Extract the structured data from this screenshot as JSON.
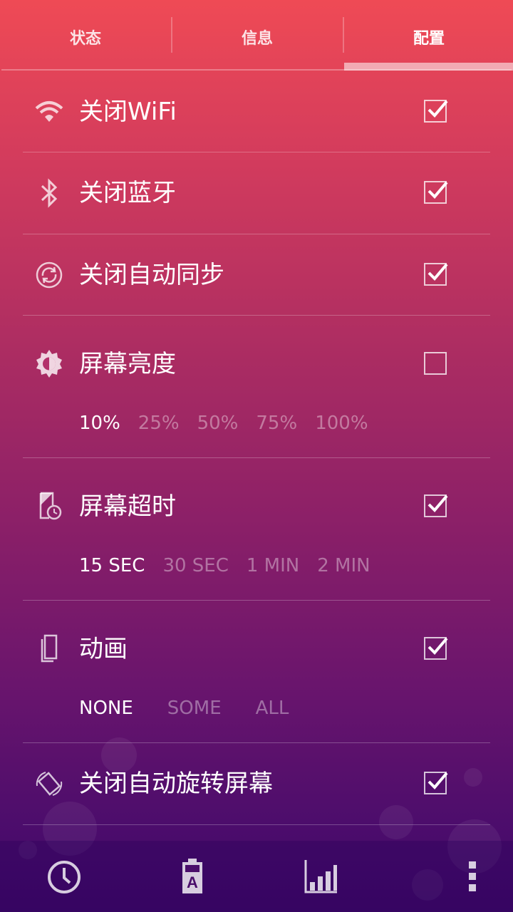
{
  "tabs": [
    {
      "label": "状态",
      "active": false
    },
    {
      "label": "信息",
      "active": false
    },
    {
      "label": "配置",
      "active": true
    }
  ],
  "settings": [
    {
      "label": "关闭WiFi",
      "icon": "wifi-icon",
      "checked": true
    },
    {
      "label": "关闭蓝牙",
      "icon": "bluetooth-icon",
      "checked": true
    },
    {
      "label": "关闭自动同步",
      "icon": "sync-icon",
      "checked": true
    },
    {
      "label": "屏幕亮度",
      "icon": "brightness-icon",
      "checked": false,
      "options": [
        "10%",
        "25%",
        "50%",
        "75%",
        "100%"
      ],
      "selected": "10%"
    },
    {
      "label": "屏幕超时",
      "icon": "screen-timeout-icon",
      "checked": true,
      "options": [
        "15 SEC",
        "30 SEC",
        "1 MIN",
        "2 MIN"
      ],
      "selected": "15 SEC"
    },
    {
      "label": "动画",
      "icon": "animation-icon",
      "checked": true,
      "options": [
        "NONE",
        "SOME",
        "ALL"
      ],
      "selected": "NONE"
    },
    {
      "label": "关闭自动旋转屏幕",
      "icon": "auto-rotate-icon",
      "checked": true
    }
  ],
  "bottom_nav": [
    {
      "icon": "clock-icon"
    },
    {
      "icon": "battery-a-icon",
      "text": "A"
    },
    {
      "icon": "bar-chart-icon"
    },
    {
      "icon": "overflow-menu-icon"
    }
  ],
  "colors": {
    "top": "#ef4a55",
    "bottom": "#3e0868"
  }
}
